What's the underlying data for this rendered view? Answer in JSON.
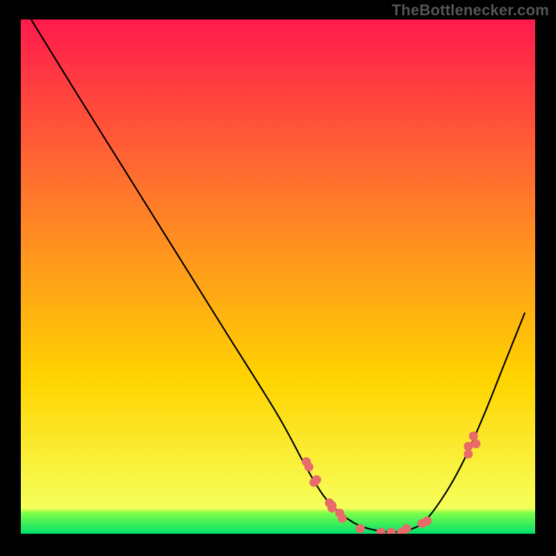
{
  "attribution": "TheBottlenecker.com",
  "chart_data": {
    "type": "line",
    "title": "",
    "xlabel": "",
    "ylabel": "",
    "xlim": [
      0,
      1
    ],
    "ylim": [
      0,
      1
    ],
    "background_gradient": {
      "top": "#ff1a4d",
      "mid": "#ffd400",
      "bottom_band": "#00e06a"
    },
    "series": [
      {
        "name": "curve",
        "color": "#000000",
        "x": [
          0.02,
          0.1,
          0.2,
          0.3,
          0.4,
          0.5,
          0.56,
          0.6,
          0.65,
          0.7,
          0.74,
          0.78,
          0.82,
          0.86,
          0.9,
          0.94,
          0.98
        ],
        "y": [
          1.0,
          0.87,
          0.71,
          0.55,
          0.39,
          0.23,
          0.12,
          0.06,
          0.02,
          0.005,
          0.005,
          0.02,
          0.07,
          0.14,
          0.23,
          0.33,
          0.43
        ]
      }
    ],
    "markers": {
      "name": "points",
      "color": "#e86a6a",
      "x": [
        0.56,
        0.555,
        0.575,
        0.57,
        0.605,
        0.605,
        0.6,
        0.625,
        0.62,
        0.66,
        0.7,
        0.72,
        0.74,
        0.75,
        0.78,
        0.79,
        0.87,
        0.87,
        0.885,
        0.88
      ],
      "y": [
        0.13,
        0.14,
        0.105,
        0.1,
        0.05,
        0.055,
        0.06,
        0.03,
        0.04,
        0.01,
        0.003,
        0.003,
        0.003,
        0.01,
        0.02,
        0.025,
        0.155,
        0.17,
        0.175,
        0.19
      ]
    }
  }
}
